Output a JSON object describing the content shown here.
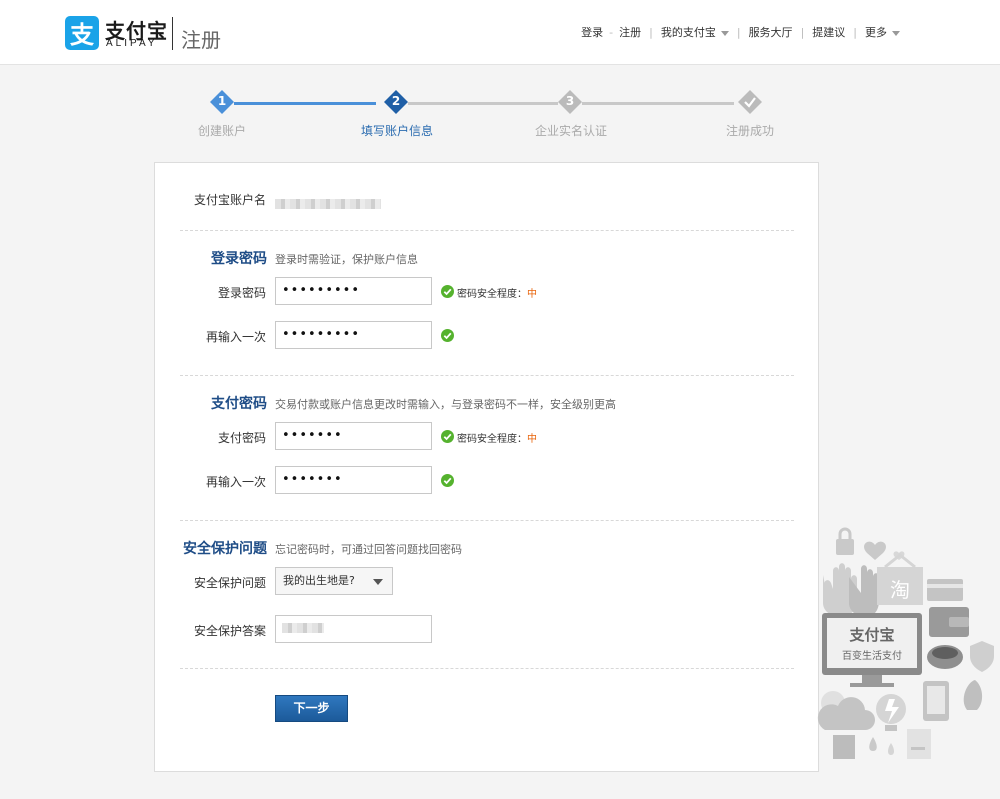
{
  "header": {
    "logo_cn": "支付宝",
    "logo_en": "ALIPAY",
    "page_title": "注册",
    "nav": {
      "login": "登录",
      "register": "注册",
      "my_alipay": "我的支付宝",
      "service_hall": "服务大厅",
      "suggest": "提建议",
      "more": "更多"
    }
  },
  "steps": [
    {
      "num": "1",
      "label": "创建账户"
    },
    {
      "num": "2",
      "label": "填写账户信息"
    },
    {
      "num": "3",
      "label": "企业实名认证"
    },
    {
      "num": "",
      "label": "注册成功"
    }
  ],
  "colors": {
    "accent": "#2b6cb0",
    "done": "#4a90d9",
    "todo": "#bbbbbb",
    "strength": "#e8630a"
  },
  "account": {
    "label": "支付宝账户名"
  },
  "login_pwd": {
    "title": "登录密码",
    "hint": "登录时需验证，保护账户信息",
    "field_label": "登录密码",
    "value": "•••••••••",
    "confirm_label": "再输入一次",
    "confirm_value": "•••••••••",
    "strength_label": "密码安全程度：",
    "strength_level": "中"
  },
  "pay_pwd": {
    "title": "支付密码",
    "hint": "交易付款或账户信息更改时需输入，与登录密码不一样，安全级别更高",
    "field_label": "支付密码",
    "value": "•••••••",
    "confirm_label": "再输入一次",
    "confirm_value": "•••••••",
    "strength_label": "密码安全程度：",
    "strength_level": "中"
  },
  "security": {
    "title": "安全保护问题",
    "hint": "忘记密码时，可通过回答问题找回密码",
    "question_label": "安全保护问题",
    "question_value": "我的出生地是?",
    "answer_label": "安全保护答案"
  },
  "next_button": "下一步",
  "promo": {
    "logo": "支付宝",
    "tagline": "百变生活支付",
    "tao": "淘"
  }
}
